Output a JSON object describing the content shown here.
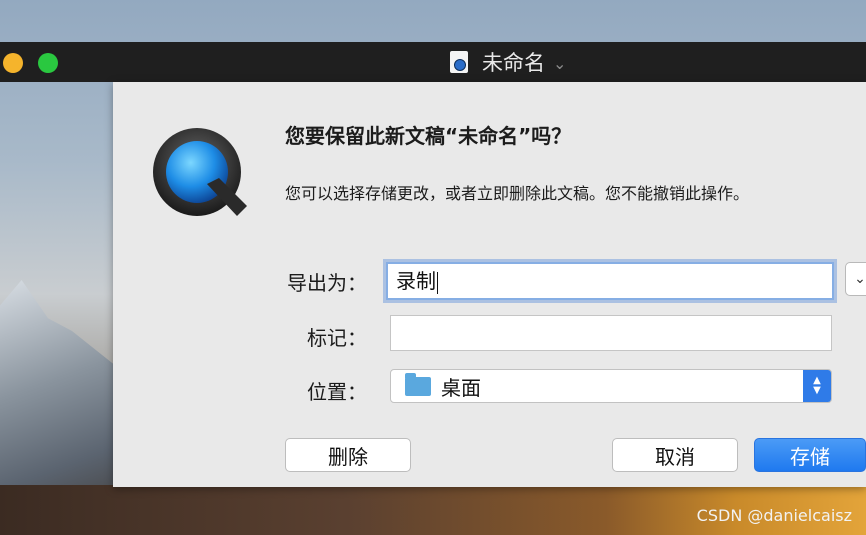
{
  "window": {
    "title": "未命名"
  },
  "dialog": {
    "heading": "您要保留此新文稿“未命名”吗？",
    "message": "您可以选择存储更改，或者立即删除此文稿。您不能撤销此操作。",
    "export_label": "导出为：",
    "export_value": "录制",
    "tags_label": "标记：",
    "tags_value": "",
    "location_label": "位置：",
    "location_value": "桌面",
    "delete_button": "删除",
    "cancel_button": "取消",
    "save_button": "存储"
  },
  "watermark": "CSDN @danielcaisz",
  "colors": {
    "accent": "#1f79ef",
    "folder": "#5aa8de",
    "titlebar": "#1f1f1f"
  }
}
